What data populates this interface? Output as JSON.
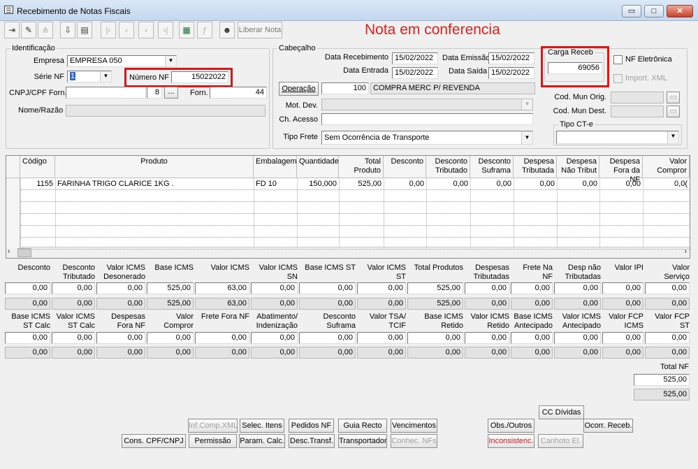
{
  "window": {
    "title": "Recebimento de Notas Fiscais",
    "controls": {
      "minimize": "▭",
      "maximize": "□",
      "close": "✕"
    }
  },
  "toolbar": {
    "liberar_label": "Liberar Nota",
    "status_message": "Nota em conferencia"
  },
  "identificacao": {
    "legend": "Identificação",
    "empresa_label": "Empresa",
    "empresa_value": "EMPRESA 050",
    "serie_label": "Série NF",
    "serie_value": "1",
    "numero_label": "Número NF",
    "numero_value": "15022022",
    "cnpj_label": "CNPJ/CPF Forn.",
    "cnpj_seq": "8",
    "browse": "...",
    "forn_label": "Forn.",
    "forn_value": "44",
    "nome_label": "Nome/Razão"
  },
  "cabecalho": {
    "legend": "Cabeçalho",
    "data_recebimento_label": "Data Recebimento",
    "data_recebimento": "15/02/2022",
    "data_emissao_label": "Data Emissão",
    "data_emissao": "15/02/2022",
    "data_entrada_label": "Data Entrada",
    "data_entrada": "15/02/2022",
    "data_saida_label": "Data Saída",
    "data_saida": "15/02/2022",
    "operacao_button": "Operação",
    "operacao_code": "100",
    "operacao_desc": "COMPRA MERC P/ REVENDA",
    "mot_dev_label": "Mot. Dev.",
    "ch_acesso_label": "Ch. Acesso",
    "tipo_frete_label": "Tipo Frete",
    "tipo_frete_value": "Sem Ocorrência de Transporte",
    "carga_legend": "Carga Receb",
    "carga_value": "69056",
    "nf_eletronica": "NF Eletrônica",
    "import_xml": "Import. XML",
    "cod_mun_orig": "Cod. Mun Orig.",
    "cod_mun_dest": "Cod. Mun Dest.",
    "tipo_cte_legend": "Tipo CT-e"
  },
  "grid": {
    "headers": [
      "Código",
      "Produto",
      "Embalagem",
      "Quantidade",
      "Total Produto",
      "Desconto",
      "Desconto Tributado",
      "Desconto Suframa",
      "Despesa Tributada",
      "Despesa Não Tribut",
      "Despesa Fora da NF",
      "Valor Compror"
    ],
    "rows": [
      [
        "1155",
        "FARINHA TRIGO CLARICE 1KG .",
        "FD  10",
        "150,000",
        "525,00",
        "0,00",
        "0,00",
        "0,00",
        "0,00",
        "0,00",
        "0,00",
        "0,0("
      ]
    ]
  },
  "totals1": {
    "headers": [
      "Desconto",
      "Desconto Tributado",
      "Valor ICMS Desonerado",
      "Base ICMS",
      "Valor ICMS",
      "Valor ICMS SN",
      "Base ICMS ST",
      "Valor ICMS ST",
      "Total Produtos",
      "Despesas Tributadas",
      "Frete Na NF",
      "Desp não Tributadas",
      "Valor IPI",
      "Valor Serviço"
    ],
    "row1": [
      "0,00",
      "0,00",
      "0,00",
      "525,00",
      "63,00",
      "0,00",
      "0,00",
      "0,00",
      "525,00",
      "0,00",
      "0,00",
      "0,00",
      "0,00",
      "0,00"
    ],
    "row2": [
      "0,00",
      "0,00",
      "0,00",
      "525,00",
      "63,00",
      "0,00",
      "0,00",
      "0,00",
      "525,00",
      "0,00",
      "0,00",
      "0,00",
      "0,00",
      "0,00"
    ]
  },
  "totals2": {
    "headers": [
      "Base ICMS ST Calc",
      "Valor ICMS ST Calc",
      "Despesas Fora NF",
      "Valor Compror",
      "Frete Fora NF",
      "Abatimento/ Indenização",
      "Desconto Suframa",
      "Valor TSA/ TCIF",
      "Base ICMS Retido",
      "Valor ICMS Retido",
      "Base ICMS Antecipado",
      "Valor ICMS Antecipado",
      "Valor FCP ICMS",
      "Valor FCP ST"
    ],
    "row1": [
      "0,00",
      "0,00",
      "0,00",
      "0,00",
      "0,00",
      "0,00",
      "0,00",
      "0,00",
      "0,00",
      "0,00",
      "0,00",
      "0,00",
      "0,00",
      "0,00"
    ],
    "row2": [
      "0,00",
      "0,00",
      "0,00",
      "0,00",
      "0,00",
      "0,00",
      "0,00",
      "0,00",
      "0,00",
      "0,00",
      "0,00",
      "0,00",
      "0,00",
      "0,00"
    ]
  },
  "total_nf": {
    "label": "Total NF",
    "value": "525,00",
    "value2": "525,00"
  },
  "buttons": {
    "inf_comp_xml": "Inf.Comp.XML",
    "selec_itens": "Selec. Itens",
    "pedidos_nf": "Pedidos NF",
    "guia_recto": "Guia Recto",
    "vencimentos": "Vencimentos",
    "cons_cpf": "Cons. CPF/CNPJ",
    "permissao": "Permissão",
    "param_calc": "Param. Calc.",
    "desc_transf": "Desc.Transf.",
    "transportador": "Transportador",
    "conhec_nfs": "Conhec. NFs",
    "cc_dividas": "CC Dívidas",
    "obs_outros": "Obs./Outros",
    "ocorr_receb": "Ocorr. Receb.",
    "inconsistenc": "Inconsistenc.",
    "canhoto": "Canhoto El."
  },
  "colors": {
    "highlight": "#e01515",
    "status": "#e02020"
  }
}
